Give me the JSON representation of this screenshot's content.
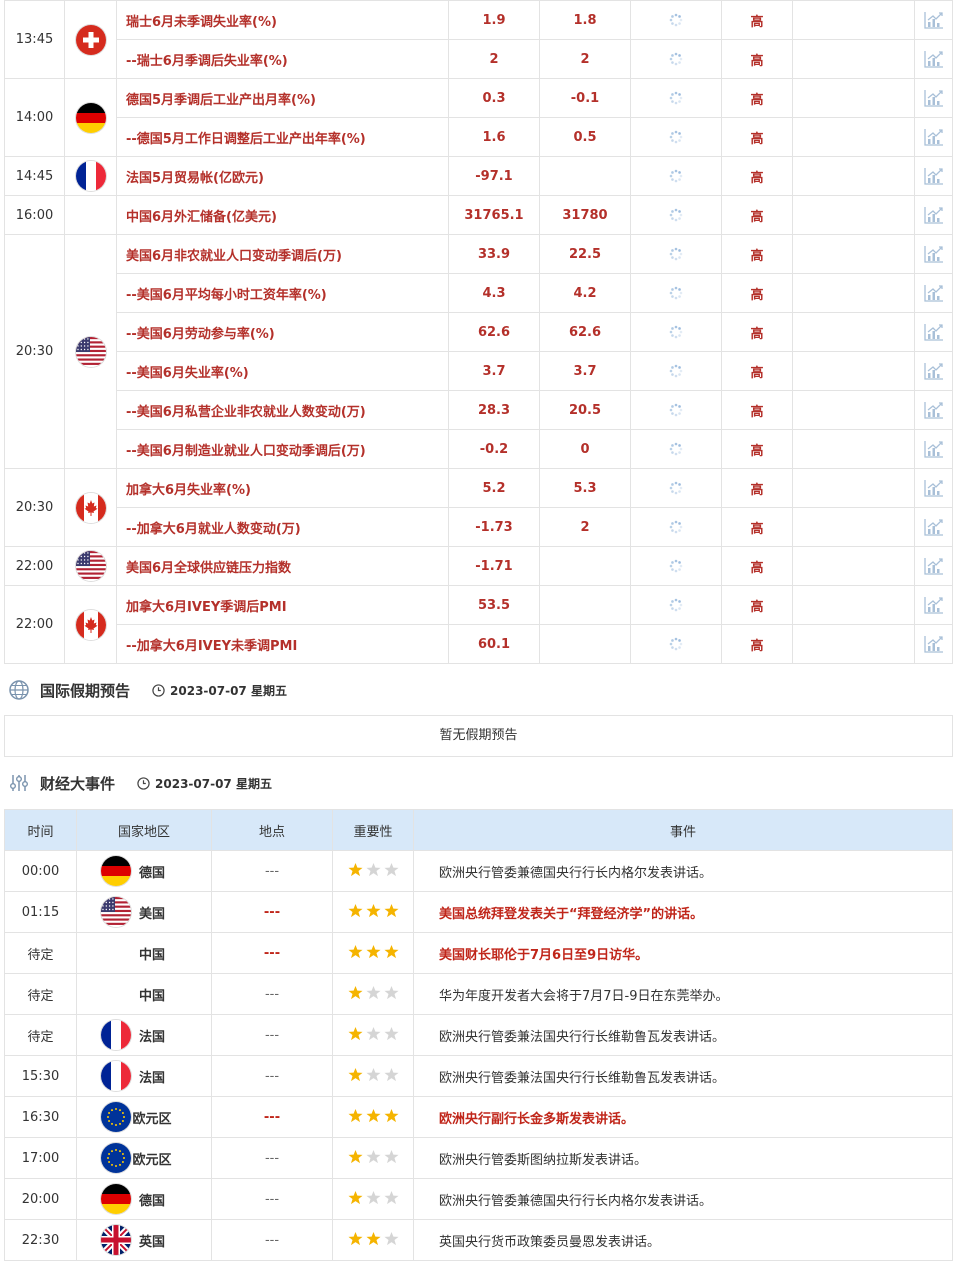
{
  "data_rows": [
    {
      "group": 0,
      "time": "13:45",
      "flag": "ch",
      "name": "瑞士6月未季调失业率(%)",
      "prev": "1.9",
      "forecast": "1.8",
      "importance": "高"
    },
    {
      "group": 0,
      "time": "",
      "flag": "",
      "name": "--瑞士6月季调后失业率(%)",
      "prev": "2",
      "forecast": "2",
      "importance": "高"
    },
    {
      "group": 1,
      "time": "14:00",
      "flag": "de",
      "name": "德国5月季调后工业产出月率(%)",
      "prev": "0.3",
      "forecast": "-0.1",
      "importance": "高"
    },
    {
      "group": 1,
      "time": "",
      "flag": "",
      "name": "--德国5月工作日调整后工业产出年率(%)",
      "prev": "1.6",
      "forecast": "0.5",
      "importance": "高"
    },
    {
      "group": 2,
      "time": "14:45",
      "flag": "fr",
      "name": "法国5月贸易帐(亿欧元)",
      "prev": "-97.1",
      "forecast": "",
      "importance": "高"
    },
    {
      "group": 3,
      "time": "16:00",
      "flag": "",
      "name": "中国6月外汇储备(亿美元)",
      "prev": "31765.1",
      "forecast": "31780",
      "importance": "高"
    },
    {
      "group": 4,
      "time": "20:30",
      "flag": "us",
      "name": "美国6月非农就业人口变动季调后(万)",
      "prev": "33.9",
      "forecast": "22.5",
      "importance": "高"
    },
    {
      "group": 4,
      "time": "",
      "flag": "",
      "name": "--美国6月平均每小时工资年率(%)",
      "prev": "4.3",
      "forecast": "4.2",
      "importance": "高"
    },
    {
      "group": 4,
      "time": "",
      "flag": "",
      "name": "--美国6月劳动参与率(%)",
      "prev": "62.6",
      "forecast": "62.6",
      "importance": "高"
    },
    {
      "group": 4,
      "time": "",
      "flag": "",
      "name": "--美国6月失业率(%)",
      "prev": "3.7",
      "forecast": "3.7",
      "importance": "高"
    },
    {
      "group": 4,
      "time": "",
      "flag": "",
      "name": "--美国6月私营企业非农就业人数变动(万)",
      "prev": "28.3",
      "forecast": "20.5",
      "importance": "高"
    },
    {
      "group": 4,
      "time": "",
      "flag": "",
      "name": "--美国6月制造业就业人口变动季调后(万)",
      "prev": "-0.2",
      "forecast": "0",
      "importance": "高"
    },
    {
      "group": 5,
      "time": "20:30",
      "flag": "ca",
      "name": "加拿大6月失业率(%)",
      "prev": "5.2",
      "forecast": "5.3",
      "importance": "高"
    },
    {
      "group": 5,
      "time": "",
      "flag": "",
      "name": "--加拿大6月就业人数变动(万)",
      "prev": "-1.73",
      "forecast": "2",
      "importance": "高"
    },
    {
      "group": 6,
      "time": "22:00",
      "flag": "us",
      "name": "美国6月全球供应链压力指数",
      "prev": "-1.71",
      "forecast": "",
      "importance": "高"
    },
    {
      "group": 7,
      "time": "22:00",
      "flag": "ca",
      "name": "加拿大6月IVEY季调后PMI",
      "prev": "53.5",
      "forecast": "",
      "importance": "高"
    },
    {
      "group": 7,
      "time": "",
      "flag": "",
      "name": "--加拿大6月IVEY未季调PMI",
      "prev": "60.1",
      "forecast": "",
      "importance": "高"
    }
  ],
  "groups": [
    {
      "time": "13:45",
      "flag": "ch",
      "rows": 2
    },
    {
      "time": "14:00",
      "flag": "de",
      "rows": 2
    },
    {
      "time": "14:45",
      "flag": "fr",
      "rows": 1
    },
    {
      "time": "16:00",
      "flag": "",
      "rows": 1
    },
    {
      "time": "20:30",
      "flag": "us",
      "rows": 6
    },
    {
      "time": "20:30",
      "flag": "ca",
      "rows": 2
    },
    {
      "time": "22:00",
      "flag": "us",
      "rows": 1
    },
    {
      "time": "22:00",
      "flag": "ca",
      "rows": 2
    }
  ],
  "holiday": {
    "title": "国际假期预告",
    "date": "2023-07-07 星期五",
    "empty_text": "暂无假期预告",
    "icon": "globe-icon"
  },
  "events": {
    "title": "财经大事件",
    "date": "2023-07-07 星期五",
    "icon": "sliders-icon",
    "headers": [
      "时间",
      "国家地区",
      "地点",
      "重要性",
      "事件"
    ],
    "rows": [
      {
        "time": "00:00",
        "flag": "de",
        "country": "德国",
        "place": "---",
        "stars": 1,
        "event": "欧洲央行管委兼德国央行行长内格尔发表讲话。",
        "highlight": false
      },
      {
        "time": "01:15",
        "flag": "us",
        "country": "美国",
        "place": "---",
        "stars": 3,
        "event": "美国总统拜登发表关于“拜登经济学”的讲话。",
        "highlight": true
      },
      {
        "time": "待定",
        "flag": "",
        "country": "中国",
        "place": "---",
        "stars": 3,
        "event": "美国财长耶伦于7月6日至9日访华。",
        "highlight": true
      },
      {
        "time": "待定",
        "flag": "",
        "country": "中国",
        "place": "---",
        "stars": 1,
        "event": "华为年度开发者大会将于7月7日-9日在东莞举办。",
        "highlight": false
      },
      {
        "time": "待定",
        "flag": "fr",
        "country": "法国",
        "place": "---",
        "stars": 1,
        "event": "欧洲央行管委兼法国央行行长维勒鲁瓦发表讲话。",
        "highlight": false
      },
      {
        "time": "15:30",
        "flag": "fr",
        "country": "法国",
        "place": "---",
        "stars": 1,
        "event": "欧洲央行管委兼法国央行行长维勒鲁瓦发表讲话。",
        "highlight": false
      },
      {
        "time": "16:30",
        "flag": "eu",
        "country": "欧元区",
        "place": "---",
        "stars": 3,
        "event": "欧洲央行副行长金多斯发表讲话。",
        "highlight": true
      },
      {
        "time": "17:00",
        "flag": "eu",
        "country": "欧元区",
        "place": "---",
        "stars": 1,
        "event": "欧洲央行管委斯图纳拉斯发表讲话。",
        "highlight": false
      },
      {
        "time": "20:00",
        "flag": "de",
        "country": "德国",
        "place": "---",
        "stars": 1,
        "event": "欧洲央行管委兼德国央行行长内格尔发表讲话。",
        "highlight": false
      },
      {
        "time": "22:30",
        "flag": "gb",
        "country": "英国",
        "place": "---",
        "stars": 2,
        "event": "英国央行货币政策委员曼恩发表讲话。",
        "highlight": false
      }
    ]
  },
  "colors": {
    "accent_red": "#b4302a",
    "header_blue": "#d7e8f9",
    "star_gold": "#f5b400",
    "star_gray": "#d5d5d5"
  }
}
